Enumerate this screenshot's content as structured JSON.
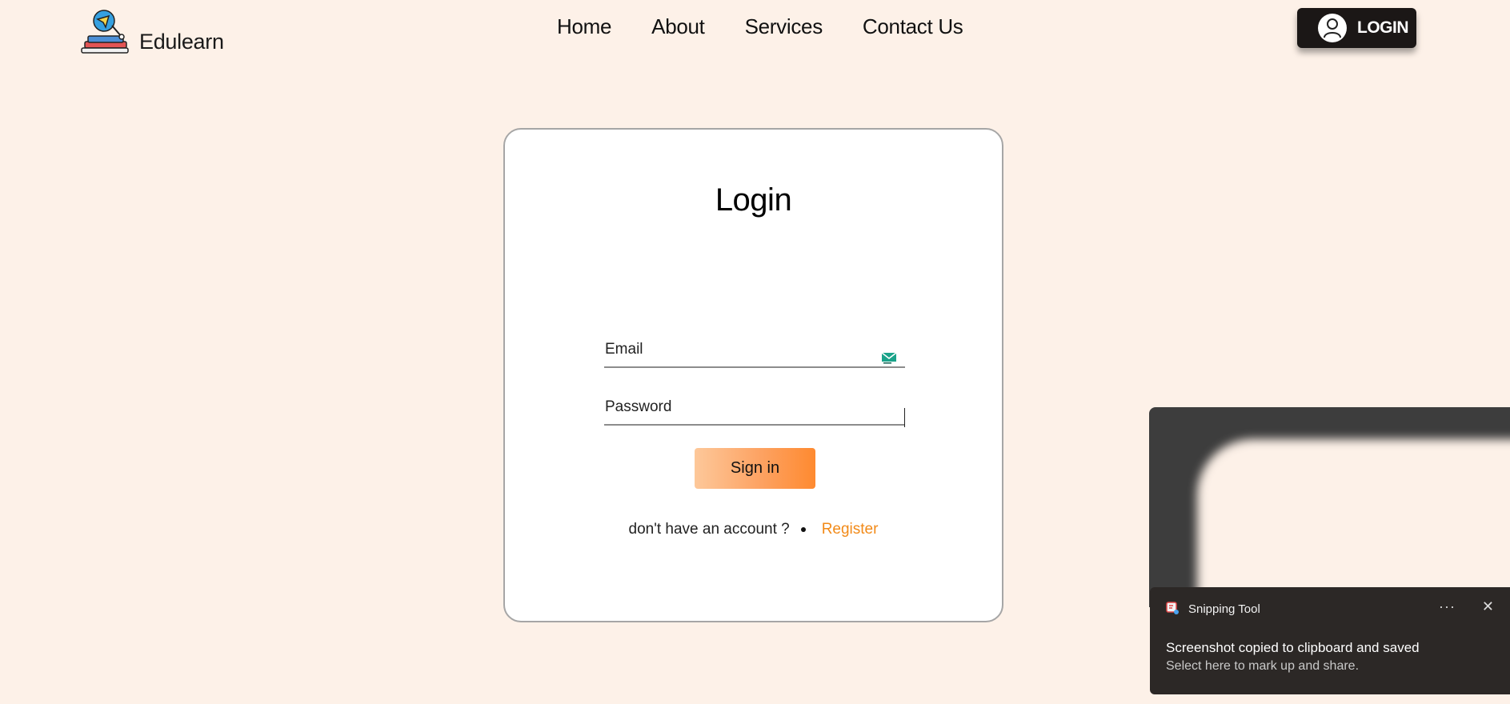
{
  "brand": {
    "name": "Edulearn",
    "logo_icon": "book-lamp-icon"
  },
  "nav": {
    "items": [
      "Home",
      "About",
      "Services",
      "Contact Us"
    ]
  },
  "header_login": {
    "label": "LOGIN",
    "icon": "user-icon"
  },
  "login_card": {
    "title": "Login",
    "email_placeholder": "Email",
    "email_icon": "mail-icon",
    "password_placeholder": "Password",
    "signin_label": "Sign in",
    "no_account_text": "don't have an account ?",
    "register_label": "Register"
  },
  "snipping_toast": {
    "app_name": "Snipping Tool",
    "title": "Screenshot copied to clipboard and saved",
    "subtitle": "Select here to mark up and share.",
    "more_label": "···",
    "close_label": "✕"
  },
  "colors": {
    "page_bg": "#fdf1e8",
    "accent": "#f28a18",
    "button_dark": "#1b1716",
    "signin_gradient_start": "#fdc89a",
    "signin_gradient_end": "#fe8a30"
  }
}
